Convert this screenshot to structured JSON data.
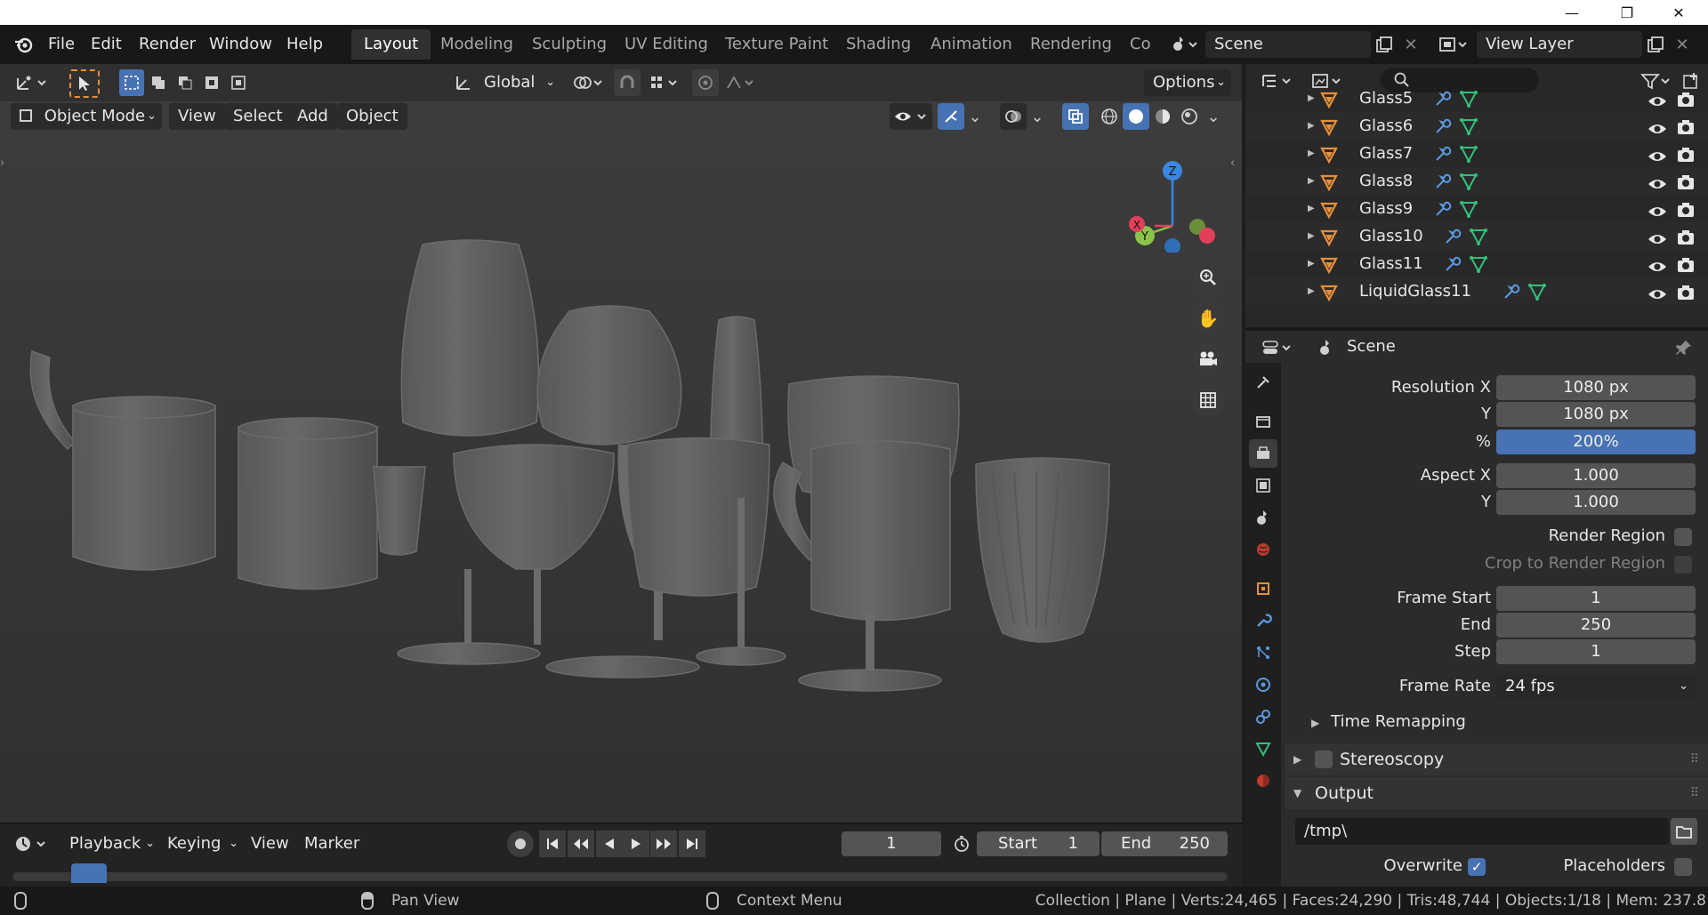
{
  "window_controls": {
    "minimize": "—",
    "maximize": "❐",
    "close": "✕"
  },
  "menu": {
    "file": "File",
    "edit": "Edit",
    "render": "Render",
    "window": "Window",
    "help": "Help"
  },
  "workspaces": [
    "Layout",
    "Modeling",
    "Sculpting",
    "UV Editing",
    "Texture Paint",
    "Shading",
    "Animation",
    "Rendering",
    "Co"
  ],
  "scene_field": "Scene",
  "view_layer_field": "View Layer",
  "toolbar": {
    "transform_orientation": "Global",
    "options": "Options"
  },
  "viewport_header": {
    "mode": "Object Mode",
    "view": "View",
    "select": "Select",
    "add": "Add",
    "object": "Object"
  },
  "gizmo": {
    "z": "Z",
    "y": "Y",
    "x": "X"
  },
  "outliner": {
    "rows": [
      {
        "name": "Glass5"
      },
      {
        "name": "Glass6"
      },
      {
        "name": "Glass7"
      },
      {
        "name": "Glass8"
      },
      {
        "name": "Glass9"
      },
      {
        "name": "Glass10"
      },
      {
        "name": "Glass11"
      },
      {
        "name": "LiquidGlass11"
      }
    ]
  },
  "properties": {
    "context": "Scene",
    "resolution_x_label": "Resolution X",
    "resolution_x": "1080 px",
    "resolution_y_label": "Y",
    "resolution_y": "1080 px",
    "percent_label": "%",
    "percent": "200%",
    "aspect_x_label": "Aspect X",
    "aspect_x": "1.000",
    "aspect_y_label": "Y",
    "aspect_y": "1.000",
    "render_region": "Render Region",
    "crop_region": "Crop to Render Region",
    "frame_start_label": "Frame Start",
    "frame_start": "1",
    "frame_end_label": "End",
    "frame_end": "250",
    "frame_step_label": "Step",
    "frame_step": "1",
    "frame_rate_label": "Frame Rate",
    "frame_rate": "24 fps",
    "time_remapping": "Time Remapping",
    "stereoscopy": "Stereoscopy",
    "output": "Output",
    "output_path": "/tmp\\",
    "overwrite": "Overwrite",
    "placeholders": "Placeholders"
  },
  "timeline": {
    "playback": "Playback",
    "keying": "Keying",
    "view": "View",
    "marker": "Marker",
    "current_frame": "1",
    "start_label": "Start",
    "start": "1",
    "end_label": "End",
    "end": "250"
  },
  "statusbar": {
    "pan_view": "Pan View",
    "context_menu": "Context Menu",
    "stats": "Collection | Plane | Verts:24,465 | Faces:24,290 | Tris:48,744 | Objects:1/18 | Mem: 237.8"
  },
  "colors": {
    "accent": "#4772b3",
    "active_tab": "#303030",
    "object_orange": "#e8903b",
    "mesh_green": "#35c07a"
  }
}
